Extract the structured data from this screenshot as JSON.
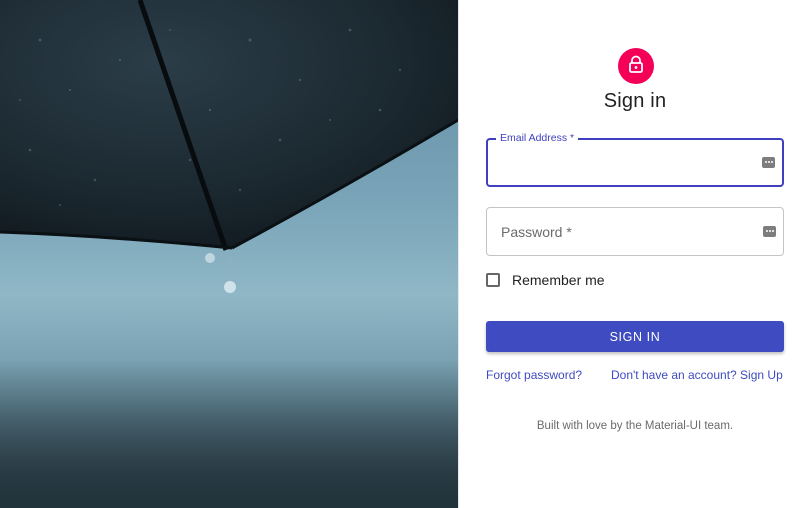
{
  "hero": {
    "description_icon": "umbrella-photo"
  },
  "form": {
    "title": "Sign in",
    "avatar_icon": "lock-icon",
    "accent_color": "#3f4bc1",
    "avatar_color": "#f50057",
    "email": {
      "label": "Email Address *",
      "value": "",
      "placeholder": ""
    },
    "password": {
      "label": "Password *",
      "value": "",
      "placeholder": "Password *"
    },
    "remember_label": "Remember me",
    "remember_checked": false,
    "submit_label": "SIGN IN",
    "forgot_link": "Forgot password?",
    "signup_link": "Don't have an account? Sign Up"
  },
  "footer": {
    "text": "Built with love by the Material-UI team."
  }
}
